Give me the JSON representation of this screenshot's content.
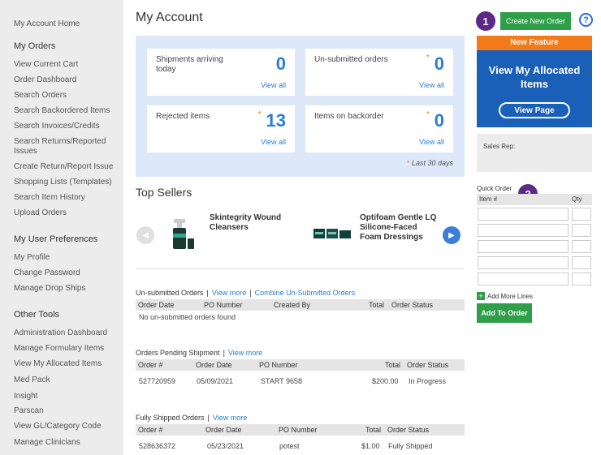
{
  "sidebar": {
    "home": "My Account Home",
    "orders_head": "My Orders",
    "orders": [
      "View Current Cart",
      "Order Dashboard",
      "Search Orders",
      "Search Backordered Items",
      "Search Invoices/Credits",
      "Search Returns/Reported",
      "Issues",
      "Create Return/Report Issue",
      "Shopping Lists (Templates)",
      "Search Item History",
      "Upload Orders"
    ],
    "prefs_head": "My User Preferences",
    "prefs": [
      "My Profile",
      "Change Password",
      "Manage Drop Ships"
    ],
    "tools_head": "Other Tools",
    "tools": [
      "Administration Dashboard",
      "Manage Formulary Items",
      "View My Allocated Items",
      "Med Pack",
      "Insight",
      "Parscan",
      "View GL/Category Code",
      "Manage Clinicians"
    ]
  },
  "page_title": "My Account",
  "stats": {
    "shipments": {
      "label": "Shipments arriving today",
      "value": "0",
      "link": "View all",
      "star": ""
    },
    "unsubmitted": {
      "label": "Un-submitted orders",
      "value": "0",
      "link": "View all",
      "star": "*"
    },
    "rejected": {
      "label": "Rejected items",
      "value": "13",
      "link": "View all",
      "star": "*"
    },
    "backorder": {
      "label": "Items on backorder",
      "value": "0",
      "link": "View all",
      "star": "*"
    },
    "footnote_star": "*",
    "footnote": "Last 30 days"
  },
  "top_sellers": {
    "title": "Top Sellers",
    "products": [
      {
        "name": "Skintegrity Wound Cleansers"
      },
      {
        "name": "Optifoam Gentle LQ Silicone-Faced Foam Dressings"
      }
    ]
  },
  "unsubmitted_section": {
    "title": "Un-submitted Orders",
    "sep": "|",
    "view_more": "View more",
    "combine": "Combine Un-Submitted Orders",
    "columns": [
      "Order Date",
      "PO Number",
      "Created By",
      "Total",
      "Order Status"
    ],
    "empty": "No un-submitted orders found"
  },
  "pending_section": {
    "title": "Orders Pending Shipment",
    "sep": "|",
    "view_more": "View more",
    "columns": [
      "Order #",
      "Order Date",
      "PO Number",
      "Total",
      "Order Status"
    ],
    "row": [
      "527720959",
      "05/09/2021",
      "START 9658",
      "$200.00",
      "In Progress"
    ]
  },
  "shipped_section": {
    "title": "Fully Shipped Orders",
    "sep": "|",
    "view_more": "View more",
    "columns": [
      "Order #",
      "Order Date",
      "PO Number",
      "Total",
      "Order Status"
    ],
    "row": [
      "528636372",
      "05/23/2021",
      "potest",
      "$1.00",
      "Fully Shipped"
    ]
  },
  "right": {
    "badge1": "1",
    "badge2": "2",
    "create_order": "Create New Order",
    "help": "?",
    "feature_bar": "New Feature",
    "feature_title": "View My Allocated Items",
    "feature_btn": "View Page",
    "sales_rep": "Sales Rep:",
    "quick_order": "Quick Order",
    "item_col": "Item #",
    "qty_col": "Qty",
    "add_lines": "Add More Lines",
    "add_to_order": "Add To Order"
  },
  "colors": {
    "accent_blue": "#2a7fd4",
    "green": "#2e9e49",
    "orange": "#f27a1a",
    "badge_purple": "#5b2a86",
    "stats_bg": "#dde9f9"
  }
}
